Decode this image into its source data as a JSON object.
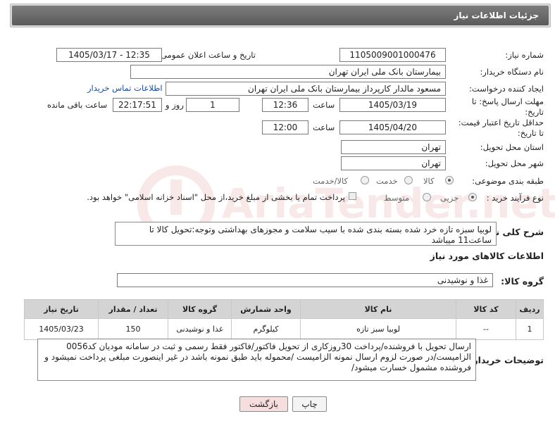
{
  "panel": {
    "title": "جزئیات اطلاعات نیاز"
  },
  "form": {
    "need_number_label": "شماره نیاز:",
    "need_number": "1105009001000476",
    "announce_label": "تاریخ و ساعت اعلان عمومی:",
    "announce_value": "1405/03/17 - 12:35",
    "buyer_label": "نام دستگاه خریدار:",
    "buyer_value": "بیمارستان بانک ملی ایران تهران",
    "creator_label": "ایجاد کننده درخواست:",
    "creator_value": "مسعود مالدار کارپرداز بیمارستان بانک ملی ایران تهران",
    "contact_link": "اطلاعات تماس خریدار",
    "deadline_label_1": "مهلت ارسال پاسخ: تا",
    "deadline_label_2": "تاریخ:",
    "deadline_date": "1405/03/19",
    "time_label": "ساعت",
    "deadline_time": "12:36",
    "days_value": "1",
    "day_and_label": "روز و",
    "remaining_value": "22:17:51",
    "remaining_label": "ساعت باقی مانده",
    "min_price_label_1": "حداقل تاریخ اعتبار قیمت:",
    "min_price_label_2": "تا تاریخ:",
    "price_date": "1405/04/20",
    "price_time": "12:00",
    "province_label": "استان محل تحویل:",
    "province_value": "تهران",
    "city_label": "شهر محل تحویل:",
    "city_value": "تهران",
    "category_label": "طبقه بندی موضوعی:",
    "category_options": [
      "کالا",
      "خدمت",
      "کالا/خدمت"
    ],
    "process_label": "نوع فرآیند خرید :",
    "process_options": [
      "جزیی",
      "متوسط"
    ],
    "payment_text": "پرداخت تمام یا بخشی از مبلغ خرید،از محل \"اسناد خزانه اسلامی\" خواهد بود."
  },
  "description": {
    "label": "شرح کلی نیاز:",
    "text": "لوبیا سبزه تازه خرد شده بسته بندی شده با سیب سلامت و مجوزهای بهداشتی وتوجه:تحویل کالا تا ساعت11 میباشد"
  },
  "goods": {
    "section_title": "اطلاعات کالاهای مورد نیاز",
    "group_label": "گروه کالا:",
    "group_value": "غذا و نوشیدنی",
    "columns": [
      "ردیف",
      "کد کالا",
      "نام کالا",
      "واحد شمارش",
      "گروه کالا",
      "تعداد / مقدار",
      "تاریخ نیاز"
    ],
    "rows": [
      [
        "1",
        "--",
        "لوبیا سبز تازه",
        "کیلوگرم",
        "غذا و نوشیدنی",
        "150",
        "1405/03/23"
      ]
    ]
  },
  "buyer_notes": {
    "label": "توضیحات خریدار:",
    "text": "ارسال تحویل با فروشنده/پرداخت 30روزکاری از تحویل فاکتور/فاکتور فقط رسمی و ثبت در سامانه مودیان کد0056 الزامیست/در صورت لزوم ارسال نمونه الزامیست /محموله باید طبق نمونه باشد در غیر اینصورت مبلغی پرداخت نمیشود و فروشنده مشمول خسارت میشود/"
  },
  "buttons": {
    "print": "چاپ",
    "back": "بازگشت"
  },
  "watermark": {
    "text": "AriaTender.net"
  },
  "colors": {
    "title_bar": "#6b6b6b",
    "link": "#1a4fa0",
    "back_button": "#f7dede",
    "watermark": "#c23b3b"
  }
}
